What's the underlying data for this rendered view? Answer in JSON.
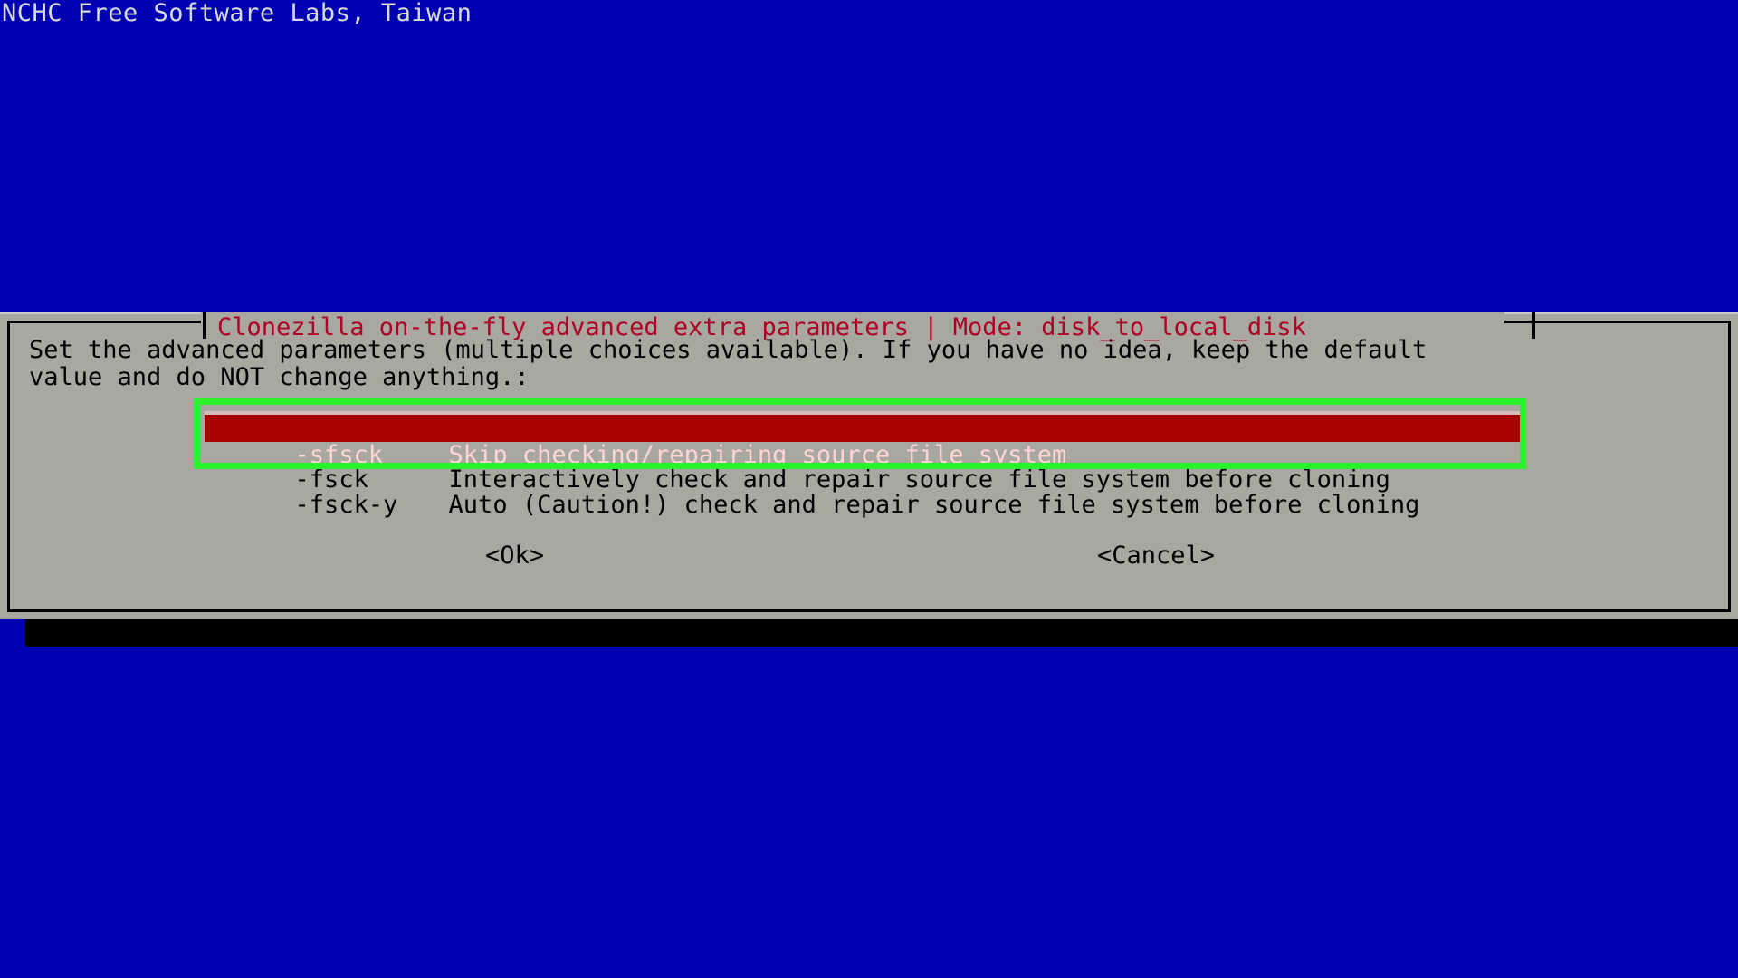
{
  "console": {
    "banner": "NCHC Free Software Labs, Taiwan"
  },
  "dialog": {
    "title": "Clonezilla on-the-fly advanced extra parameters | Mode: disk_to_local_disk",
    "title_program": "Clonezilla on-the-fly advanced extra parameters",
    "title_separator": "|",
    "title_mode_label": "Mode:",
    "title_mode_value": "disk_to_local_disk",
    "prompt": "Set the advanced parameters (multiple choices available). If you have no idea, keep the default\nvalue and do NOT change anything.:",
    "options": [
      {
        "key": "-sfsck",
        "description": "Skip checking/repairing source file system",
        "selected": true
      },
      {
        "key": "-fsck",
        "description": "Interactively check and repair source file system before cloning",
        "selected": false
      },
      {
        "key": "-fsck-y",
        "description": "Auto (Caution!) check and repair source file system before cloning",
        "selected": false
      }
    ],
    "buttons": {
      "ok": "<Ok>",
      "cancel": "<Cancel>"
    }
  },
  "colors": {
    "background_blue": "#0000b3",
    "dialog_gray": "#a8a8a0",
    "title_red": "#b00024",
    "selection_red": "#a80000",
    "selection_text": "#ffd4d4",
    "annotation_green": "#2cf02c",
    "shadow_black": "#000000",
    "console_text": "#d9d9d9"
  }
}
